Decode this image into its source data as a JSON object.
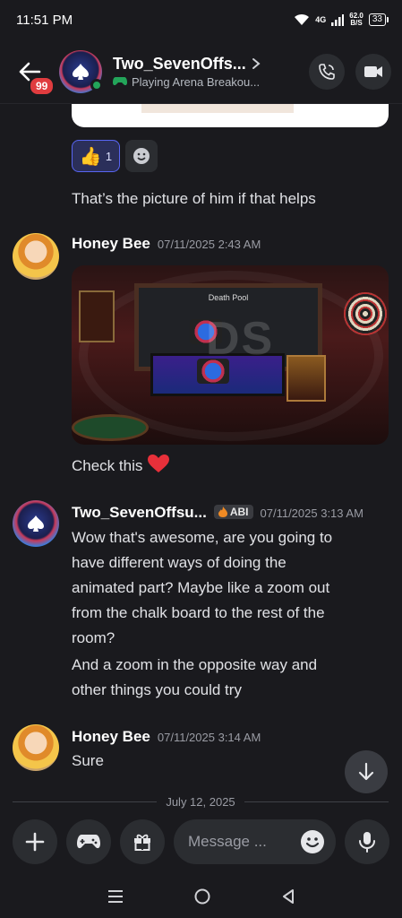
{
  "status_bar": {
    "time": "11:51 PM",
    "network": "4G",
    "speed_value": "62.0",
    "speed_unit": "B/S",
    "battery": "33"
  },
  "header": {
    "unread_count": "99",
    "title": "Two_SevenOffs...",
    "activity": "Playing Arena Breakou..."
  },
  "reactions": [
    {
      "emoji": "👍",
      "count": "1"
    }
  ],
  "messages": [
    {
      "author": "",
      "time": "",
      "text": "That’s the picture of him if that helps"
    },
    {
      "author": "Honey Bee",
      "time": "07/11/2025 2:43 AM",
      "image_title": "Death Pool",
      "image_watermark": "DS",
      "caption": "Check this"
    },
    {
      "author": "Two_SevenOffsu...",
      "tag": "ABI",
      "time": "07/11/2025 3:13 AM",
      "lines": [
        "Wow that's awesome, are you going to",
        "have different ways of doing the",
        "animated part? Maybe like a zoom out",
        "from the chalk board to the rest of the",
        "room?"
      ],
      "lines2": [
        "And a zoom in the opposite way and",
        "other things you could try"
      ]
    },
    {
      "author": "Honey Bee",
      "time": "07/11/2025 3:14 AM",
      "text": "Sure"
    }
  ],
  "date_divider": "July 12, 2025",
  "composer": {
    "placeholder": "Message ..."
  },
  "colors": {
    "background": "#1a1a1e",
    "accent": "#5865f2",
    "online": "#23a55a",
    "badge": "#e03c3f"
  }
}
